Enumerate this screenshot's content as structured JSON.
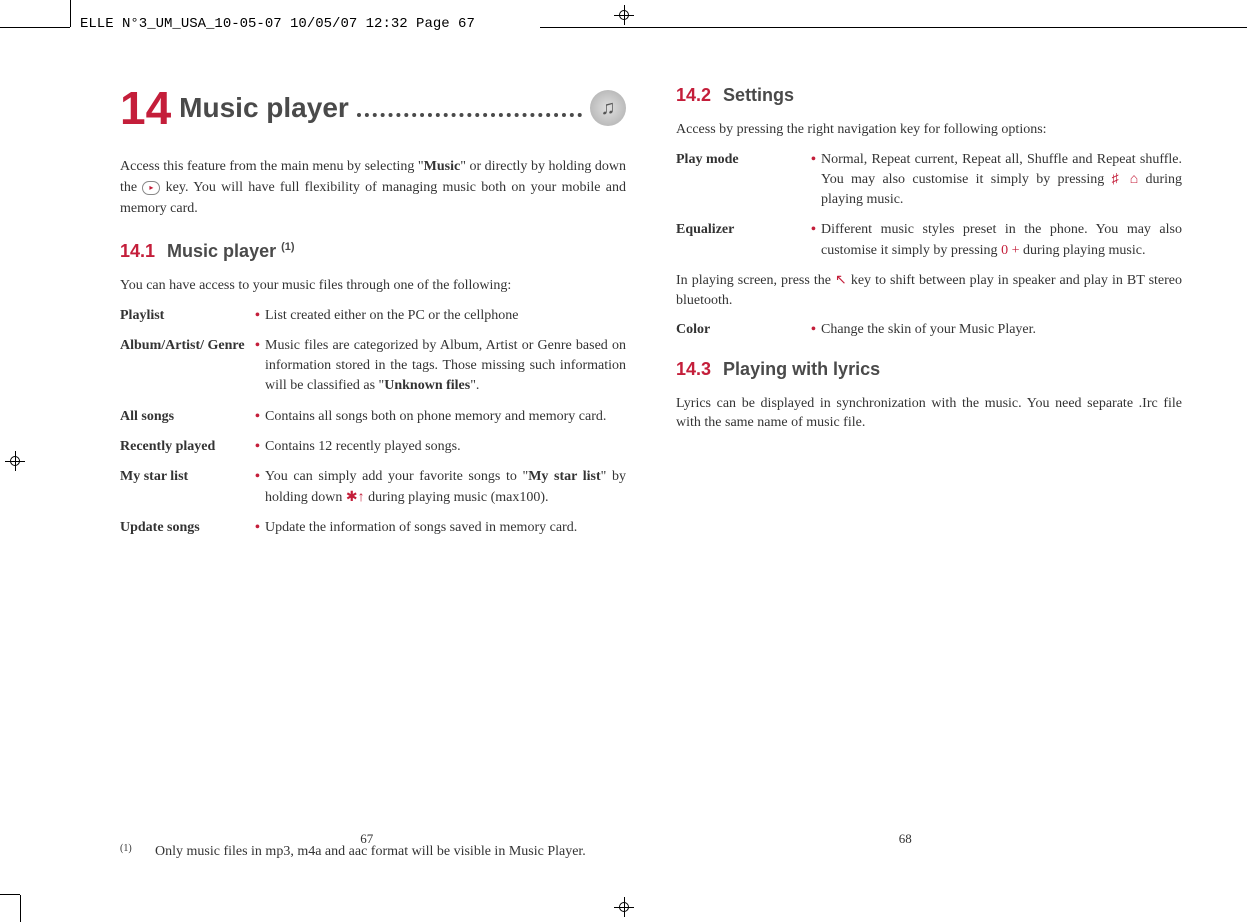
{
  "slug": "ELLE N°3_UM_USA_10-05-07  10/05/07  12:32  Page 67",
  "chapter": {
    "number": "14",
    "title": "Music player"
  },
  "intro": {
    "part1": "Access this feature from the main menu by selecting \"",
    "bold1": "Music",
    "part2": "\" or directly by holding down the ",
    "keyIcon": "▸",
    "part3": " key. You will have full flexibility of managing music both on your mobile and memory card."
  },
  "section14_1": {
    "num": "14.1",
    "title": "Music player ",
    "super": "(1)",
    "desc": "You can have access to your music files through one of the following:",
    "items": [
      {
        "term": "Playlist",
        "desc": "List created either on the PC or the cellphone"
      },
      {
        "term": "Album/Artist/ Genre",
        "desc_pre": "Music files are categorized by Album, Artist or Genre based on information stored in the tags. Those missing such information will be classified as \"",
        "desc_bold": "Unknown files",
        "desc_post": "\"."
      },
      {
        "term": "All songs",
        "desc": "Contains all songs both on phone memory and memory card."
      },
      {
        "term": "Recently played",
        "desc": "Contains 12 recently played songs."
      },
      {
        "term": "My star list",
        "desc_pre": "You can simply add your favorite songs to \"",
        "desc_bold": "My star list",
        "desc_mid": "\" by holding down ",
        "desc_glyph": "✱↑",
        "desc_post": " during playing music (max100)."
      },
      {
        "term": "Update songs",
        "desc": "Update the information of songs saved in memory card."
      }
    ]
  },
  "section14_2": {
    "num": "14.2",
    "title": "Settings",
    "desc": "Access by pressing the right navigation key for following options:",
    "items": [
      {
        "term": "Play mode",
        "desc_pre": "Normal, Repeat current, Repeat all, Shuffle and Repeat shuffle. You may also customise it simply by pressing ",
        "desc_glyph": "♯ ⌂",
        "desc_post": " during playing music."
      },
      {
        "term": "Equalizer",
        "desc_pre": "Different music styles preset in the phone. You may also customise it simply by pressing ",
        "desc_glyph": "0 +",
        "desc_post": " during playing music."
      }
    ],
    "midtext_pre": "In playing screen, press the ",
    "midtext_glyph": "↖",
    "midtext_post": " key to shift between play in speaker and play in BT stereo bluetooth.",
    "color": {
      "term": "Color",
      "desc": "Change the skin of your Music Player."
    }
  },
  "section14_3": {
    "num": "14.3",
    "title": "Playing with lyrics",
    "body": "Lyrics can be displayed in synchronization with the music. You need separate .Irc file with the same name of music file."
  },
  "footnote": {
    "marker": "(1)",
    "text": "Only music files in mp3, m4a and aac format will be visible in Music Player."
  },
  "pageNumbers": {
    "left": "67",
    "right": "68"
  }
}
